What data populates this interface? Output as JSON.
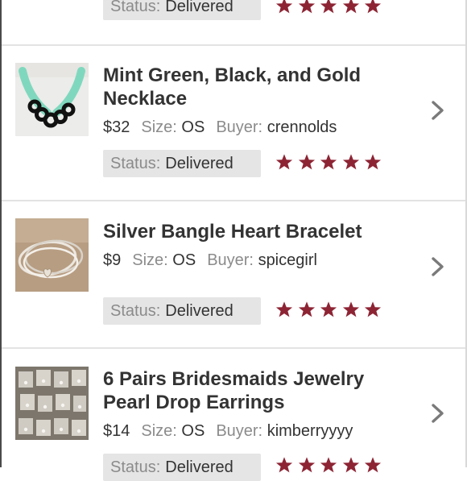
{
  "labels": {
    "size": "Size:",
    "buyer": "Buyer:",
    "status": "Status:"
  },
  "colors": {
    "star": "#8d2434",
    "chevron": "#7a7a7a"
  },
  "orders": [
    {
      "title": "",
      "price": "",
      "size": "",
      "buyer": "",
      "status": "Delivered",
      "rating": 5
    },
    {
      "title": "Mint Green, Black, and Gold Necklace",
      "price": "$32",
      "size": "OS",
      "buyer": "crennolds",
      "status": "Delivered",
      "rating": 5,
      "icon": "chevron-right-icon"
    },
    {
      "title": "Silver Bangle Heart Bracelet",
      "price": "$9",
      "size": "OS",
      "buyer": "spicegirl",
      "status": "Delivered",
      "rating": 5,
      "icon": "chevron-right-icon"
    },
    {
      "title": "6 Pairs Bridesmaids Jewelry Pearl Drop Earrings",
      "price": "$14",
      "size": "OS",
      "buyer": "kimberryyyy",
      "status": "Delivered",
      "rating": 5,
      "icon": "chevron-right-icon"
    }
  ]
}
